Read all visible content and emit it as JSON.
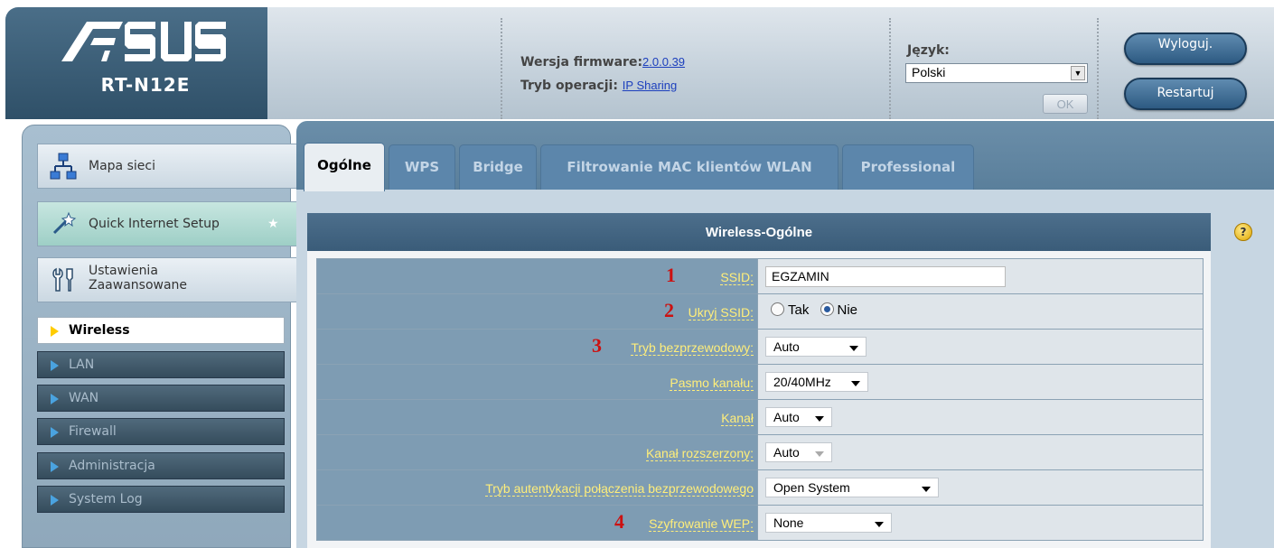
{
  "header": {
    "brand": "ASUS",
    "model": "RT-N12E",
    "firmware_label": "Wersja firmware:",
    "firmware_value": "2.0.0.39",
    "mode_label": "Tryb operacji:",
    "mode_value": "IP Sharing",
    "lang_label": "Język:",
    "lang_value": "Polski",
    "ok_label": "OK",
    "logout_label": "Wyloguj.",
    "restart_label": "Restartuj"
  },
  "sidebar": {
    "items": [
      {
        "label": "Mapa sieci"
      },
      {
        "label": "Quick Internet Setup"
      },
      {
        "label": "Ustawienia Zaawansowane",
        "line1": "Ustawienia",
        "line2": "Zaawansowane"
      }
    ],
    "sub": [
      {
        "label": "Wireless"
      },
      {
        "label": "LAN"
      },
      {
        "label": "WAN"
      },
      {
        "label": "Firewall"
      },
      {
        "label": "Administracja"
      },
      {
        "label": "System Log"
      }
    ]
  },
  "tabs": [
    {
      "label": "Ogólne"
    },
    {
      "label": "WPS"
    },
    {
      "label": "Bridge"
    },
    {
      "label": "Filtrowanie MAC klientów WLAN"
    },
    {
      "label": "Professional"
    }
  ],
  "panel": {
    "title": "Wireless-Ogólne",
    "rows": [
      {
        "num": "1",
        "label": "SSID:",
        "value": "EGZAMIN"
      },
      {
        "num": "2",
        "label": "Ukryj SSID:",
        "opt_yes": "Tak",
        "opt_no": "Nie"
      },
      {
        "num": "3",
        "label": "Tryb bezprzewodowy:",
        "value": "Auto"
      },
      {
        "num": "",
        "label": "Pasmo kanału:",
        "value": "20/40MHz"
      },
      {
        "num": "",
        "label": "Kanał",
        "value": "Auto"
      },
      {
        "num": "",
        "label": "Kanał rozszerzony:",
        "value": "Auto"
      },
      {
        "num": "",
        "label": "Tryb autentykacji połączenia bezprzewodowego",
        "value": "Open System"
      },
      {
        "num": "4",
        "label": "Szyfrowanie WEP:",
        "value": "None"
      }
    ]
  }
}
